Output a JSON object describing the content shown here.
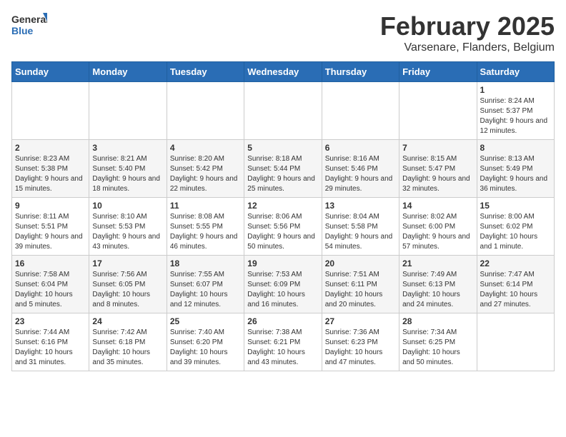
{
  "header": {
    "logo_general": "General",
    "logo_blue": "Blue",
    "month_title": "February 2025",
    "location": "Varsenare, Flanders, Belgium"
  },
  "weekdays": [
    "Sunday",
    "Monday",
    "Tuesday",
    "Wednesday",
    "Thursday",
    "Friday",
    "Saturday"
  ],
  "weeks": [
    [
      {
        "day": "",
        "info": ""
      },
      {
        "day": "",
        "info": ""
      },
      {
        "day": "",
        "info": ""
      },
      {
        "day": "",
        "info": ""
      },
      {
        "day": "",
        "info": ""
      },
      {
        "day": "",
        "info": ""
      },
      {
        "day": "1",
        "info": "Sunrise: 8:24 AM\nSunset: 5:37 PM\nDaylight: 9 hours and 12 minutes."
      }
    ],
    [
      {
        "day": "2",
        "info": "Sunrise: 8:23 AM\nSunset: 5:38 PM\nDaylight: 9 hours and 15 minutes."
      },
      {
        "day": "3",
        "info": "Sunrise: 8:21 AM\nSunset: 5:40 PM\nDaylight: 9 hours and 18 minutes."
      },
      {
        "day": "4",
        "info": "Sunrise: 8:20 AM\nSunset: 5:42 PM\nDaylight: 9 hours and 22 minutes."
      },
      {
        "day": "5",
        "info": "Sunrise: 8:18 AM\nSunset: 5:44 PM\nDaylight: 9 hours and 25 minutes."
      },
      {
        "day": "6",
        "info": "Sunrise: 8:16 AM\nSunset: 5:46 PM\nDaylight: 9 hours and 29 minutes."
      },
      {
        "day": "7",
        "info": "Sunrise: 8:15 AM\nSunset: 5:47 PM\nDaylight: 9 hours and 32 minutes."
      },
      {
        "day": "8",
        "info": "Sunrise: 8:13 AM\nSunset: 5:49 PM\nDaylight: 9 hours and 36 minutes."
      }
    ],
    [
      {
        "day": "9",
        "info": "Sunrise: 8:11 AM\nSunset: 5:51 PM\nDaylight: 9 hours and 39 minutes."
      },
      {
        "day": "10",
        "info": "Sunrise: 8:10 AM\nSunset: 5:53 PM\nDaylight: 9 hours and 43 minutes."
      },
      {
        "day": "11",
        "info": "Sunrise: 8:08 AM\nSunset: 5:55 PM\nDaylight: 9 hours and 46 minutes."
      },
      {
        "day": "12",
        "info": "Sunrise: 8:06 AM\nSunset: 5:56 PM\nDaylight: 9 hours and 50 minutes."
      },
      {
        "day": "13",
        "info": "Sunrise: 8:04 AM\nSunset: 5:58 PM\nDaylight: 9 hours and 54 minutes."
      },
      {
        "day": "14",
        "info": "Sunrise: 8:02 AM\nSunset: 6:00 PM\nDaylight: 9 hours and 57 minutes."
      },
      {
        "day": "15",
        "info": "Sunrise: 8:00 AM\nSunset: 6:02 PM\nDaylight: 10 hours and 1 minute."
      }
    ],
    [
      {
        "day": "16",
        "info": "Sunrise: 7:58 AM\nSunset: 6:04 PM\nDaylight: 10 hours and 5 minutes."
      },
      {
        "day": "17",
        "info": "Sunrise: 7:56 AM\nSunset: 6:05 PM\nDaylight: 10 hours and 8 minutes."
      },
      {
        "day": "18",
        "info": "Sunrise: 7:55 AM\nSunset: 6:07 PM\nDaylight: 10 hours and 12 minutes."
      },
      {
        "day": "19",
        "info": "Sunrise: 7:53 AM\nSunset: 6:09 PM\nDaylight: 10 hours and 16 minutes."
      },
      {
        "day": "20",
        "info": "Sunrise: 7:51 AM\nSunset: 6:11 PM\nDaylight: 10 hours and 20 minutes."
      },
      {
        "day": "21",
        "info": "Sunrise: 7:49 AM\nSunset: 6:13 PM\nDaylight: 10 hours and 24 minutes."
      },
      {
        "day": "22",
        "info": "Sunrise: 7:47 AM\nSunset: 6:14 PM\nDaylight: 10 hours and 27 minutes."
      }
    ],
    [
      {
        "day": "23",
        "info": "Sunrise: 7:44 AM\nSunset: 6:16 PM\nDaylight: 10 hours and 31 minutes."
      },
      {
        "day": "24",
        "info": "Sunrise: 7:42 AM\nSunset: 6:18 PM\nDaylight: 10 hours and 35 minutes."
      },
      {
        "day": "25",
        "info": "Sunrise: 7:40 AM\nSunset: 6:20 PM\nDaylight: 10 hours and 39 minutes."
      },
      {
        "day": "26",
        "info": "Sunrise: 7:38 AM\nSunset: 6:21 PM\nDaylight: 10 hours and 43 minutes."
      },
      {
        "day": "27",
        "info": "Sunrise: 7:36 AM\nSunset: 6:23 PM\nDaylight: 10 hours and 47 minutes."
      },
      {
        "day": "28",
        "info": "Sunrise: 7:34 AM\nSunset: 6:25 PM\nDaylight: 10 hours and 50 minutes."
      },
      {
        "day": "",
        "info": ""
      }
    ]
  ]
}
